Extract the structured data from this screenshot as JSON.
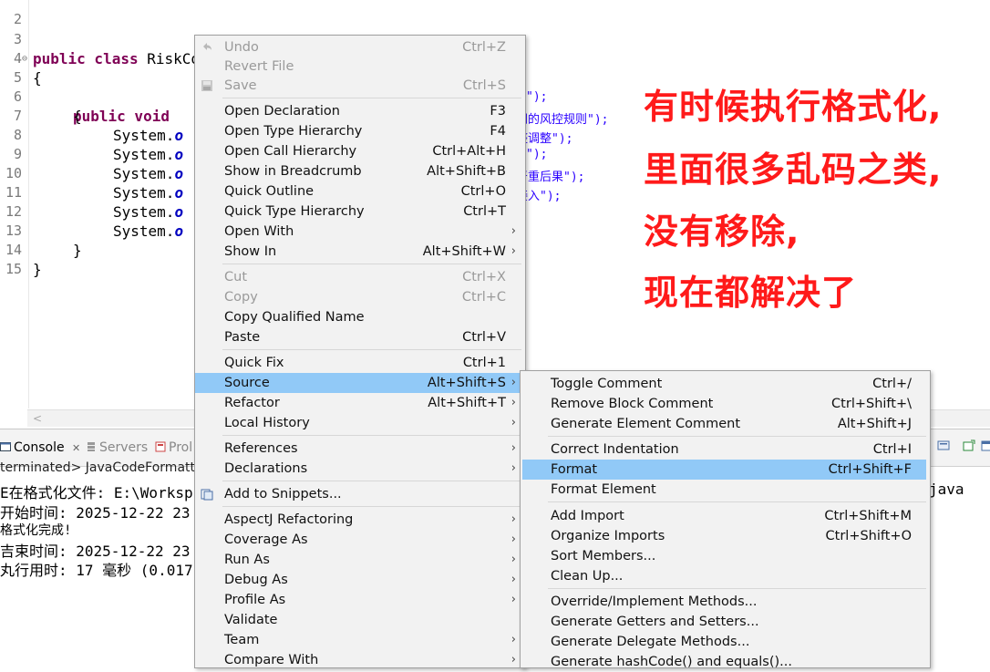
{
  "editor": {
    "top_line_number": "2",
    "lines": [
      {
        "num": "3",
        "kw": "public class",
        "text": " RiskControlChallenges"
      },
      {
        "num": "4",
        "text": "{"
      },
      {
        "num": "5",
        "kw": "public void",
        "text": ""
      },
      {
        "num": "6",
        "text": "{"
      },
      {
        "num": "7",
        "text": "System.",
        "fld": "o"
      },
      {
        "num": "8",
        "text": "System.",
        "fld": "o"
      },
      {
        "num": "9",
        "text": "System.",
        "fld": "o"
      },
      {
        "num": "10",
        "text": "System.",
        "fld": "o"
      },
      {
        "num": "11",
        "text": "System.",
        "fld": "o"
      },
      {
        "num": "12",
        "text": "System.",
        "fld": "o"
      },
      {
        "num": "13",
        "text": "}"
      },
      {
        "num": "14",
        "text": "}"
      },
      {
        "num": "15",
        "text": ""
      }
    ],
    "string_fragments": [
      "\");",
      "同的风控规则\");",
      "整调整\");",
      "\");",
      "严重后果\");",
      "接入\");"
    ]
  },
  "console": {
    "tabs": [
      {
        "label": "Console",
        "close": "✕"
      },
      {
        "label": "Servers"
      },
      {
        "label": "Prol"
      }
    ],
    "terminated": "terminated> JavaCodeFormatte",
    "output_lines": [
      "E在格式化文件: E:\\Worksp",
      "开始时间: 2025-12-22 23",
      "格式化完成!",
      "吉束时间: 2025-12-22 23",
      "丸行用时: 17 毫秒 (0.017"
    ],
    "right_fragment": "java"
  },
  "context_menu": {
    "items": [
      {
        "label": "Undo",
        "shortcut": "Ctrl+Z",
        "disabled": true,
        "icon": "undo-icon"
      },
      {
        "label": "Revert File",
        "shortcut": "",
        "disabled": true
      },
      {
        "label": "Save",
        "shortcut": "Ctrl+S",
        "disabled": true,
        "icon": "save-icon"
      },
      {
        "label": "Open Declaration",
        "shortcut": "F3"
      },
      {
        "label": "Open Type Hierarchy",
        "shortcut": "F4"
      },
      {
        "label": "Open Call Hierarchy",
        "shortcut": "Ctrl+Alt+H"
      },
      {
        "label": "Show in Breadcrumb",
        "shortcut": "Alt+Shift+B"
      },
      {
        "label": "Quick Outline",
        "shortcut": "Ctrl+O"
      },
      {
        "label": "Quick Type Hierarchy",
        "shortcut": "Ctrl+T"
      },
      {
        "label": "Open With",
        "shortcut": "",
        "submenu": true
      },
      {
        "label": "Show In",
        "shortcut": "Alt+Shift+W",
        "submenu": true
      },
      {
        "label": "Cut",
        "shortcut": "Ctrl+X",
        "disabled": true
      },
      {
        "label": "Copy",
        "shortcut": "Ctrl+C",
        "disabled": true
      },
      {
        "label": "Copy Qualified Name",
        "shortcut": ""
      },
      {
        "label": "Paste",
        "shortcut": "Ctrl+V"
      },
      {
        "label": "Quick Fix",
        "shortcut": "Ctrl+1"
      },
      {
        "label": "Source",
        "shortcut": "Alt+Shift+S",
        "submenu": true,
        "highlight": true
      },
      {
        "label": "Refactor",
        "shortcut": "Alt+Shift+T",
        "submenu": true
      },
      {
        "label": "Local History",
        "shortcut": "",
        "submenu": true
      },
      {
        "label": "References",
        "shortcut": "",
        "submenu": true
      },
      {
        "label": "Declarations",
        "shortcut": "",
        "submenu": true
      },
      {
        "label": "Add to Snippets...",
        "shortcut": "",
        "icon": "snippet-icon"
      },
      {
        "label": "AspectJ Refactoring",
        "shortcut": "",
        "submenu": true
      },
      {
        "label": "Coverage As",
        "shortcut": "",
        "submenu": true
      },
      {
        "label": "Run As",
        "shortcut": "",
        "submenu": true
      },
      {
        "label": "Debug As",
        "shortcut": "",
        "submenu": true
      },
      {
        "label": "Profile As",
        "shortcut": "",
        "submenu": true
      },
      {
        "label": "Validate",
        "shortcut": ""
      },
      {
        "label": "Team",
        "shortcut": "",
        "submenu": true
      },
      {
        "label": "Compare With",
        "shortcut": "",
        "submenu": true
      }
    ],
    "submenu_arrow": "›"
  },
  "source_submenu": {
    "items": [
      {
        "label": "Toggle Comment",
        "shortcut": "Ctrl+/"
      },
      {
        "label": "Remove Block Comment",
        "shortcut": "Ctrl+Shift+\\"
      },
      {
        "label": "Generate Element Comment",
        "shortcut": "Alt+Shift+J"
      },
      {
        "label": "Correct Indentation",
        "shortcut": "Ctrl+I"
      },
      {
        "label": "Format",
        "shortcut": "Ctrl+Shift+F",
        "highlight": true
      },
      {
        "label": "Format Element",
        "shortcut": ""
      },
      {
        "label": "Add Import",
        "shortcut": "Ctrl+Shift+M"
      },
      {
        "label": "Organize Imports",
        "shortcut": "Ctrl+Shift+O"
      },
      {
        "label": "Sort Members...",
        "shortcut": ""
      },
      {
        "label": "Clean Up...",
        "shortcut": ""
      },
      {
        "label": "Override/Implement Methods...",
        "shortcut": ""
      },
      {
        "label": "Generate Getters and Setters...",
        "shortcut": ""
      },
      {
        "label": "Generate Delegate Methods...",
        "shortcut": ""
      },
      {
        "label": "Generate hashCode() and equals()...",
        "shortcut": ""
      }
    ]
  },
  "annotation": {
    "lines": [
      "有时候执行格式化,",
      "里面很多乱码之类,",
      "没有移除,",
      "现在都解决了"
    ],
    "color": "#ff1a1a"
  }
}
